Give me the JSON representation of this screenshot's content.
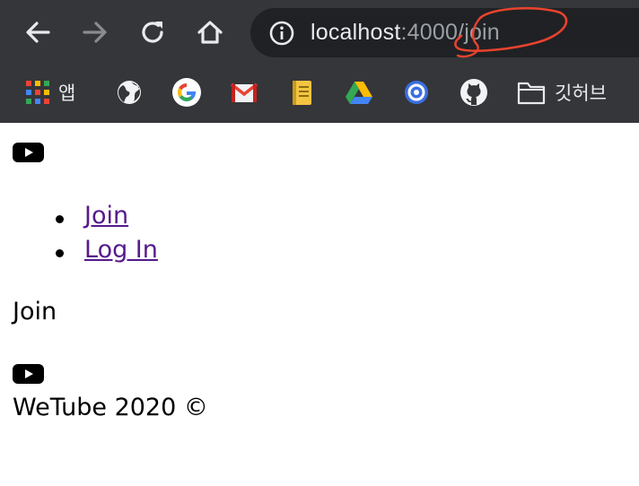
{
  "browser": {
    "url_host": "localhost",
    "url_rest": ":4000/join",
    "bookmarks": [
      {
        "icon": "apps-grid-icon",
        "label": "앱"
      },
      {
        "icon": "globe-icon",
        "label": ""
      },
      {
        "icon": "google-icon",
        "label": ""
      },
      {
        "icon": "gmail-icon",
        "label": ""
      },
      {
        "icon": "notebook-icon",
        "label": ""
      },
      {
        "icon": "google-drive-icon",
        "label": ""
      },
      {
        "icon": "blue-circle-icon",
        "label": ""
      },
      {
        "icon": "github-icon",
        "label": ""
      },
      {
        "icon": "folder-icon",
        "label": "깃허브"
      }
    ]
  },
  "page": {
    "nav": [
      {
        "label": "Join"
      },
      {
        "label": "Log In"
      }
    ],
    "heading": "Join",
    "footer": "WeTube 2020 ©"
  },
  "colors": {
    "chrome_bg": "#35363a",
    "omnibox_bg": "#202124",
    "link_visited": "#551a8b",
    "annotation_red": "#e8432e"
  }
}
